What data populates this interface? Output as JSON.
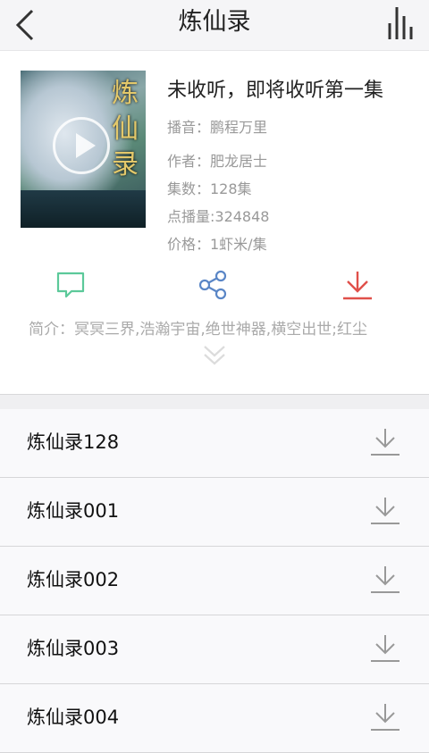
{
  "header": {
    "title": "炼仙录",
    "back_icon": "chevron-left-icon",
    "player_icon": "equalizer-icon"
  },
  "book": {
    "status": "未收听，即将收听第一集",
    "narrator": "播音：鹏程万里",
    "author": "作者：肥龙居士",
    "episodes": "集数：128集",
    "plays": "点播量:324848",
    "price": "价格：1虾米/集",
    "cover_title": "炼仙录"
  },
  "actions": {
    "comment_icon": "comment-icon",
    "share_icon": "share-icon",
    "download_icon": "download-icon",
    "colors": {
      "comment": "#5cc99a",
      "share": "#5a86c6",
      "download": "#e0504a"
    }
  },
  "intro": "简介：冥冥三界,浩瀚宇宙,绝世神器,横空出世;红尘",
  "list": {
    "items": [
      {
        "label": "炼仙录128"
      },
      {
        "label": "炼仙录001"
      },
      {
        "label": "炼仙录002"
      },
      {
        "label": "炼仙录003"
      },
      {
        "label": "炼仙录004"
      }
    ]
  }
}
